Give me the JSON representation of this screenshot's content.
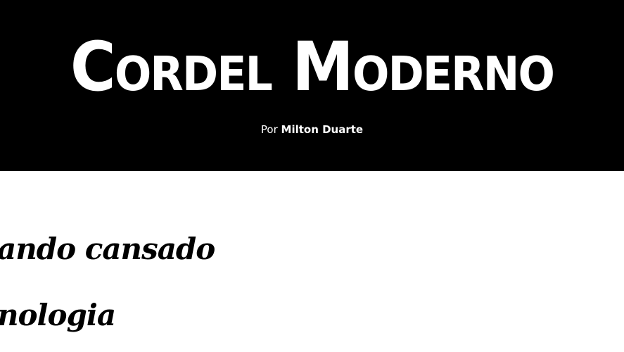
{
  "header": {
    "title": "Cordel Moderno",
    "byline_prefix": "Por",
    "byline_author": "Milton Duarte"
  },
  "content": {
    "lines": [
      "ando cansado",
      "nologia"
    ]
  },
  "colors": {
    "header_bg": "#000000",
    "header_text": "#ffffff",
    "body_bg": "#ffffff",
    "body_text": "#000000"
  }
}
